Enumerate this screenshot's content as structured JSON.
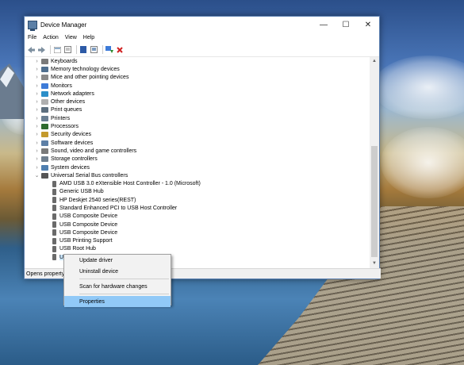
{
  "window": {
    "title": "Device Manager",
    "controls": {
      "minimize": "—",
      "maximize": "☐",
      "close": "✕"
    }
  },
  "menu": [
    "File",
    "Action",
    "View",
    "Help"
  ],
  "toolbar_icons": [
    "back-icon",
    "forward-icon",
    "show-hide-icon",
    "properties-icon",
    "help-icon",
    "view-icon",
    "update-driver-icon",
    "uninstall-icon"
  ],
  "tree": {
    "categories": [
      {
        "label": "Keyboards",
        "expanded": false,
        "icon": "keyboard-icon",
        "color": "#7a7a7a"
      },
      {
        "label": "Memory technology devices",
        "expanded": false,
        "icon": "memory-icon",
        "color": "#4f6f8f"
      },
      {
        "label": "Mice and other pointing devices",
        "expanded": false,
        "icon": "mouse-icon",
        "color": "#8a8a8a"
      },
      {
        "label": "Monitors",
        "expanded": false,
        "icon": "monitor-icon",
        "color": "#3d7bd8"
      },
      {
        "label": "Network adapters",
        "expanded": false,
        "icon": "network-icon",
        "color": "#2c8fc9"
      },
      {
        "label": "Other devices",
        "expanded": false,
        "icon": "other-device-icon",
        "color": "#b0b0b0"
      },
      {
        "label": "Print queues",
        "expanded": false,
        "icon": "print-queue-icon",
        "color": "#5d6f7f"
      },
      {
        "label": "Printers",
        "expanded": false,
        "icon": "printer-icon",
        "color": "#6a7f93"
      },
      {
        "label": "Processors",
        "expanded": false,
        "icon": "processor-icon",
        "color": "#2e6b2e"
      },
      {
        "label": "Security devices",
        "expanded": false,
        "icon": "security-icon",
        "color": "#c49a2c"
      },
      {
        "label": "Software devices",
        "expanded": false,
        "icon": "software-icon",
        "color": "#5d7fa6"
      },
      {
        "label": "Sound, video and game controllers",
        "expanded": false,
        "icon": "sound-icon",
        "color": "#7a7a7a"
      },
      {
        "label": "Storage controllers",
        "expanded": false,
        "icon": "storage-icon",
        "color": "#6f7f8f"
      },
      {
        "label": "System devices",
        "expanded": false,
        "icon": "system-icon",
        "color": "#4f7fb0"
      },
      {
        "label": "Universal Serial Bus controllers",
        "expanded": true,
        "icon": "usb-icon",
        "color": "#555555"
      }
    ],
    "usb_children": [
      "AMD USB 3.0 eXtensible Host Controller - 1.0 (Microsoft)",
      "Generic USB Hub",
      "HP Deskjet 2540 series(REST)",
      "Standard Enhanced PCI to USB Host Controller",
      "USB Composite Device",
      "USB Composite Device",
      "USB Composite Device",
      "USB Printing Support",
      "USB Root Hub",
      "USB Root Hub (USB 3.0)"
    ],
    "selected_index": 9
  },
  "statusbar": {
    "text": "Opens property s"
  },
  "context_menu": {
    "items": [
      "Update driver",
      "Uninstall device",
      "Scan for hardware changes",
      "Properties"
    ],
    "highlighted": "Properties"
  }
}
